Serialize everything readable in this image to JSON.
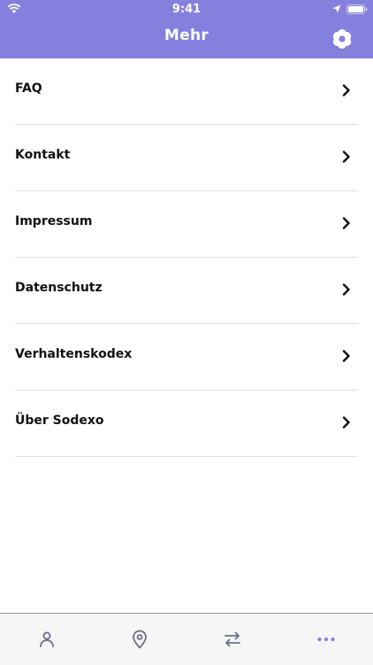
{
  "status_bar": {
    "time": "9:41"
  },
  "header": {
    "title": "Mehr",
    "settings_icon": "settings-flower-icon"
  },
  "menu": {
    "items": [
      {
        "label": "FAQ"
      },
      {
        "label": "Kontakt"
      },
      {
        "label": "Impressum"
      },
      {
        "label": "Datenschutz"
      },
      {
        "label": "Verhaltenskodex"
      },
      {
        "label": "Über Sodexo"
      }
    ]
  },
  "tab_bar": {
    "tabs": [
      {
        "icon": "person-icon",
        "active": false
      },
      {
        "icon": "map-pin-icon",
        "active": false
      },
      {
        "icon": "transfer-arrows-icon",
        "active": false
      },
      {
        "icon": "more-dots-icon",
        "active": true
      }
    ]
  },
  "colors": {
    "header": "#8580dd",
    "tab_inactive": "#6b6f8a",
    "tab_active": "#8580dd"
  }
}
